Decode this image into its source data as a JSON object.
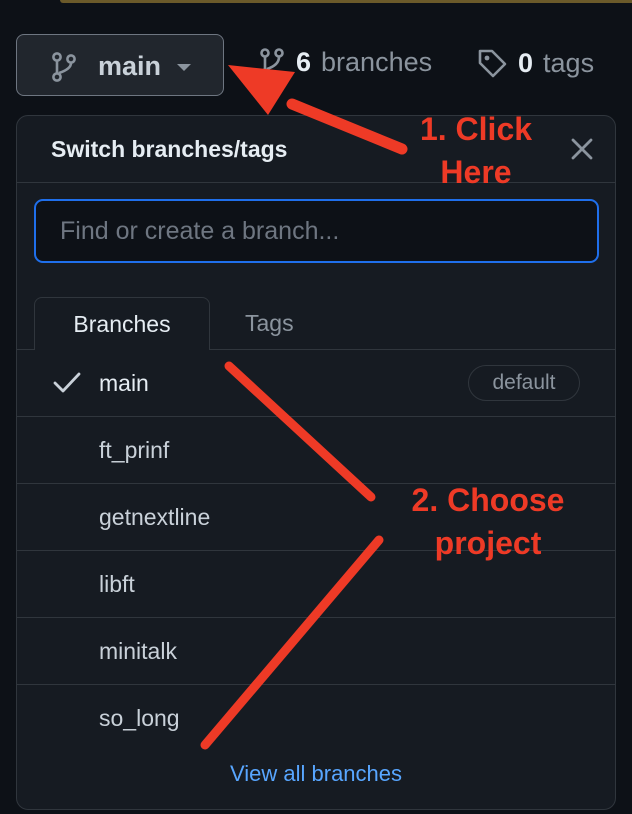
{
  "repo": {
    "branch_button_label": "main",
    "branch_count": "6",
    "branches_word": "branches",
    "tag_count": "0",
    "tags_word": "tags"
  },
  "dropdown": {
    "title": "Switch branches/tags",
    "filter_placeholder": "Find or create a branch...",
    "tabs": [
      {
        "label": "Branches",
        "selected": true
      },
      {
        "label": "Tags",
        "selected": false
      }
    ],
    "branches": [
      {
        "name": "main",
        "current": true,
        "badge": "default"
      },
      {
        "name": "ft_prinf"
      },
      {
        "name": "getnextline"
      },
      {
        "name": "libft"
      },
      {
        "name": "minitalk"
      },
      {
        "name": "so_long"
      }
    ],
    "view_all": "View all branches"
  },
  "annotations": {
    "step1": [
      "1. Click",
      "Here"
    ],
    "step2": [
      "2. Choose",
      "project"
    ]
  },
  "colors": {
    "background": "#0d1117",
    "panel": "#161b22",
    "border": "#30363d",
    "focus_ring": "#1f6feb",
    "link": "#58a6ff",
    "annotation": "#ee3a26"
  }
}
